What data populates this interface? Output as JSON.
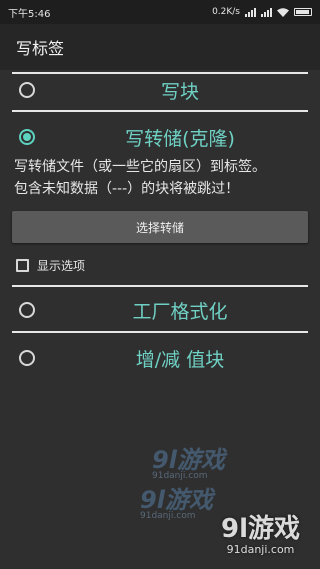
{
  "status_bar": {
    "time": "下午5:46",
    "net_speed": "0.2K/s"
  },
  "app_bar": {
    "title": "写标签"
  },
  "options": [
    {
      "label": "写块",
      "checked": false
    },
    {
      "label": "写转储(克隆)",
      "checked": true
    },
    {
      "label": "工厂格式化",
      "checked": false
    },
    {
      "label": "增/减 值块",
      "checked": false
    }
  ],
  "description": {
    "line1": "写转储文件（或一些它的扇区）到标签。",
    "line2": "包含未知数据（---）的块将被跳过！"
  },
  "dump_button": {
    "label": "选择转储"
  },
  "show_options": {
    "label": "显示选项",
    "checked": false
  },
  "watermarks": {
    "logo": "9l游戏",
    "site": "91danji.com"
  },
  "colors": {
    "accent": "#5ed2c0",
    "label_teal": "#6fd0c4",
    "background": "#2f2f2f",
    "app_bar": "#262626",
    "button": "#5a5a5a"
  }
}
